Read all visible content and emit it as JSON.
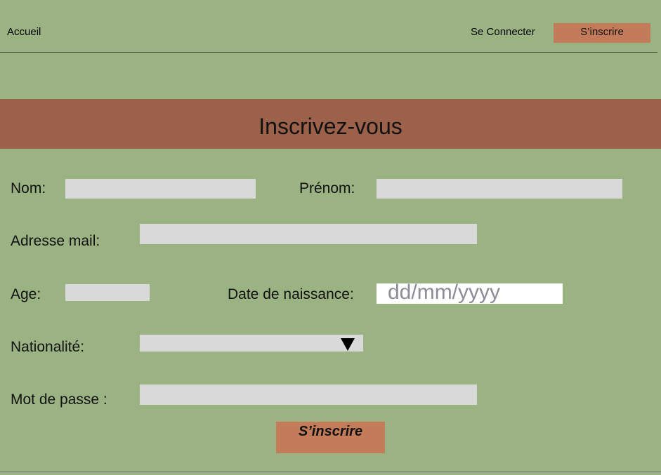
{
  "nav": {
    "home": "Accueil",
    "login": "Se Connecter",
    "signup": "S’inscrire"
  },
  "banner": {
    "title": "Inscrivez-vous"
  },
  "form": {
    "nom_label": "Nom:",
    "nom_value": "",
    "prenom_label": "Prénom:",
    "prenom_value": "",
    "email_label": "Adresse mail:",
    "email_value": "",
    "age_label": "Age:",
    "age_value": "",
    "birthdate_label": "Date de naissance:",
    "birthdate_placeholder": "dd/mm/yyyy",
    "nationality_label": "Nationalité:",
    "nationality_value": "",
    "password_label": "Mot de passe :",
    "password_value": "",
    "submit_label": "S’inscrire"
  },
  "colors": {
    "background": "#9bb383",
    "banner": "#9c614a",
    "accent": "#c47b5a",
    "field": "#d9d9d9"
  },
  "icons": {
    "select_arrow": "triangle-down-icon"
  }
}
